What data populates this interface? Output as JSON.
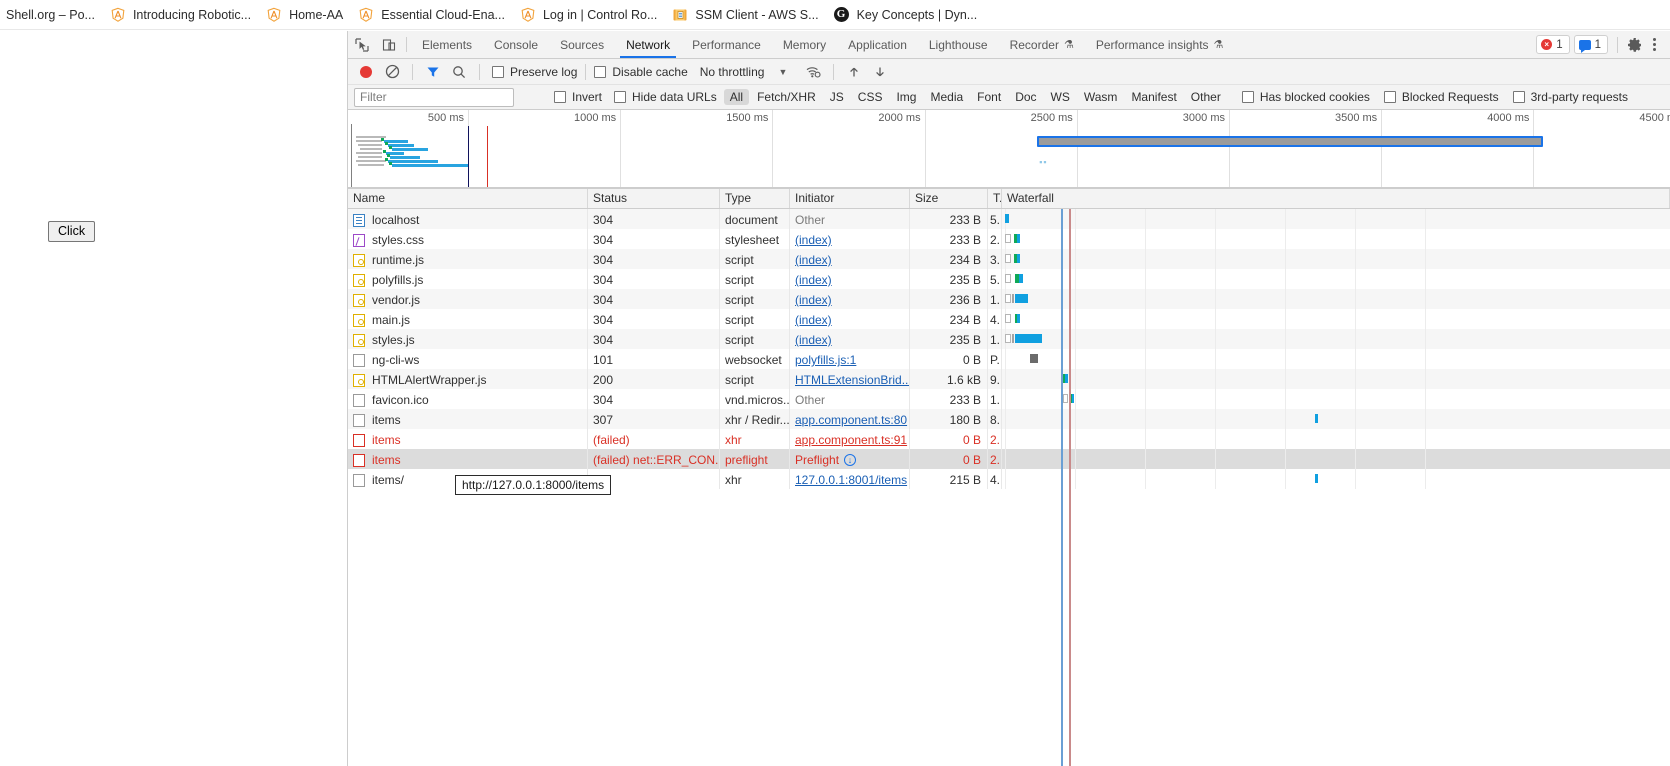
{
  "browser": {
    "bookmarks": [
      {
        "label": "Shell.org – Po...",
        "icon": "none"
      },
      {
        "label": "Introducing Robotic...",
        "icon": "angular-icon"
      },
      {
        "label": "Home-AA",
        "icon": "angular-icon"
      },
      {
        "label": "Essential Cloud-Ena...",
        "icon": "angular-icon"
      },
      {
        "label": "Log in | Control Ro...",
        "icon": "angular-icon"
      },
      {
        "label": "SSM Client - AWS S...",
        "icon": "aws-icon"
      },
      {
        "label": "Key Concepts | Dyn...",
        "icon": "g-circle-icon"
      }
    ]
  },
  "page": {
    "click_button_label": "Click"
  },
  "devtools": {
    "tabs": [
      {
        "label": "Elements",
        "selected": false,
        "warn": false
      },
      {
        "label": "Console",
        "selected": false,
        "warn": false
      },
      {
        "label": "Sources",
        "selected": false,
        "warn": false
      },
      {
        "label": "Network",
        "selected": true,
        "warn": false
      },
      {
        "label": "Performance",
        "selected": false,
        "warn": false
      },
      {
        "label": "Memory",
        "selected": false,
        "warn": false
      },
      {
        "label": "Application",
        "selected": false,
        "warn": false
      },
      {
        "label": "Lighthouse",
        "selected": false,
        "warn": false
      },
      {
        "label": "Recorder",
        "selected": false,
        "warn": true
      },
      {
        "label": "Performance insights",
        "selected": false,
        "warn": true
      }
    ],
    "status": {
      "error_count": "1",
      "message_count": "1"
    },
    "toolbar": {
      "record_title": "record-button",
      "clear_title": "clear-button",
      "filter_title": "filter-button",
      "search_title": "search-button",
      "preserve_log_label": "Preserve log",
      "preserve_log_checked": false,
      "disable_cache_label": "Disable cache",
      "disable_cache_checked": false,
      "throttling_value": "No throttling",
      "import_title": "import-har",
      "export_title": "export-har"
    },
    "filter_bar": {
      "filter_placeholder": "Filter",
      "filter_value": "",
      "invert_label": "Invert",
      "invert_checked": false,
      "hide_data_urls_label": "Hide data URLs",
      "hide_data_urls_checked": false,
      "types": [
        {
          "label": "All",
          "selected": true
        },
        {
          "label": "Fetch/XHR",
          "selected": false
        },
        {
          "label": "JS",
          "selected": false
        },
        {
          "label": "CSS",
          "selected": false
        },
        {
          "label": "Img",
          "selected": false
        },
        {
          "label": "Media",
          "selected": false
        },
        {
          "label": "Font",
          "selected": false
        },
        {
          "label": "Doc",
          "selected": false
        },
        {
          "label": "WS",
          "selected": false
        },
        {
          "label": "Wasm",
          "selected": false
        },
        {
          "label": "Manifest",
          "selected": false
        },
        {
          "label": "Other",
          "selected": false
        }
      ],
      "has_blocked_cookies_label": "Has blocked cookies",
      "has_blocked_cookies_checked": false,
      "blocked_requests_label": "Blocked Requests",
      "blocked_requests_checked": false,
      "third_party_label": "3rd-party requests",
      "third_party_checked": false
    },
    "overview": {
      "ticks": [
        "500 ms",
        "1000 ms",
        "1500 ms",
        "2000 ms",
        "2500 ms",
        "3000 ms",
        "3500 ms",
        "4000 ms",
        "4500 ms"
      ],
      "selection_start_ms": 2370,
      "selection_end_ms": 4030
    },
    "table": {
      "columns": [
        "Name",
        "Status",
        "Type",
        "Initiator",
        "Size",
        "T.",
        "Waterfall"
      ],
      "rows": [
        {
          "name": "localhost",
          "icon": "document-icon",
          "status": "304",
          "type": "document",
          "initiator": "Other",
          "initiator_link": false,
          "size": "233 B",
          "time": "5.",
          "failed": false,
          "selected": false
        },
        {
          "name": "styles.css",
          "icon": "stylesheet-icon",
          "status": "304",
          "type": "stylesheet",
          "initiator": "(index)",
          "initiator_link": true,
          "size": "233 B",
          "time": "2.",
          "failed": false,
          "selected": false
        },
        {
          "name": "runtime.js",
          "icon": "script-icon",
          "status": "304",
          "type": "script",
          "initiator": "(index)",
          "initiator_link": true,
          "size": "234 B",
          "time": "3.",
          "failed": false,
          "selected": false
        },
        {
          "name": "polyfills.js",
          "icon": "script-icon",
          "status": "304",
          "type": "script",
          "initiator": "(index)",
          "initiator_link": true,
          "size": "235 B",
          "time": "5.",
          "failed": false,
          "selected": false
        },
        {
          "name": "vendor.js",
          "icon": "script-icon",
          "status": "304",
          "type": "script",
          "initiator": "(index)",
          "initiator_link": true,
          "size": "236 B",
          "time": "1.",
          "failed": false,
          "selected": false
        },
        {
          "name": "main.js",
          "icon": "script-icon",
          "status": "304",
          "type": "script",
          "initiator": "(index)",
          "initiator_link": true,
          "size": "234 B",
          "time": "4.",
          "failed": false,
          "selected": false
        },
        {
          "name": "styles.js",
          "icon": "script-icon",
          "status": "304",
          "type": "script",
          "initiator": "(index)",
          "initiator_link": true,
          "size": "235 B",
          "time": "1.",
          "failed": false,
          "selected": false
        },
        {
          "name": "ng-cli-ws",
          "icon": "generic-icon",
          "status": "101",
          "type": "websocket",
          "initiator": "polyfills.js:1",
          "initiator_link": true,
          "size": "0 B",
          "time": "P.",
          "failed": false,
          "selected": false
        },
        {
          "name": "HTMLAlertWrapper.js",
          "icon": "script-icon",
          "status": "200",
          "type": "script",
          "initiator": "HTMLExtensionBrid...",
          "initiator_link": true,
          "size": "1.6 kB",
          "time": "9.",
          "failed": false,
          "selected": false
        },
        {
          "name": "favicon.ico",
          "icon": "generic-icon",
          "status": "304",
          "type": "vnd.micros...",
          "initiator": "Other",
          "initiator_link": false,
          "size": "233 B",
          "time": "1.",
          "failed": false,
          "selected": false
        },
        {
          "name": "items",
          "icon": "generic-icon",
          "status": "307",
          "type": "xhr / Redir...",
          "initiator": "app.component.ts:80",
          "initiator_link": true,
          "size": "180 B",
          "time": "8.",
          "failed": false,
          "selected": false
        },
        {
          "name": "items",
          "icon": "generic-icon",
          "status": "(failed)",
          "type": "xhr",
          "initiator": "app.component.ts:91",
          "initiator_link": true,
          "size": "0 B",
          "time": "2.",
          "failed": true,
          "selected": false
        },
        {
          "name": "items",
          "icon": "generic-icon",
          "status": "(failed) net::ERR_CON...",
          "type": "preflight",
          "initiator": "Preflight",
          "initiator_link": false,
          "initiator_badge": true,
          "size": "0 B",
          "time": "2.",
          "failed": true,
          "selected": true
        },
        {
          "name": "items/",
          "icon": "generic-icon",
          "status": "0",
          "type": "xhr",
          "initiator": "127.0.0.1:8001/items",
          "initiator_link": true,
          "size": "215 B",
          "time": "4.",
          "failed": false,
          "selected": false
        }
      ]
    },
    "tooltip": {
      "text": "http://127.0.0.1:8000/items"
    }
  },
  "colors": {
    "accent": "#1a73e8",
    "error": "#d93025",
    "download_bar": "#10a0e0",
    "waiting_bar": "#0fa958",
    "record_red": "#e53935"
  }
}
